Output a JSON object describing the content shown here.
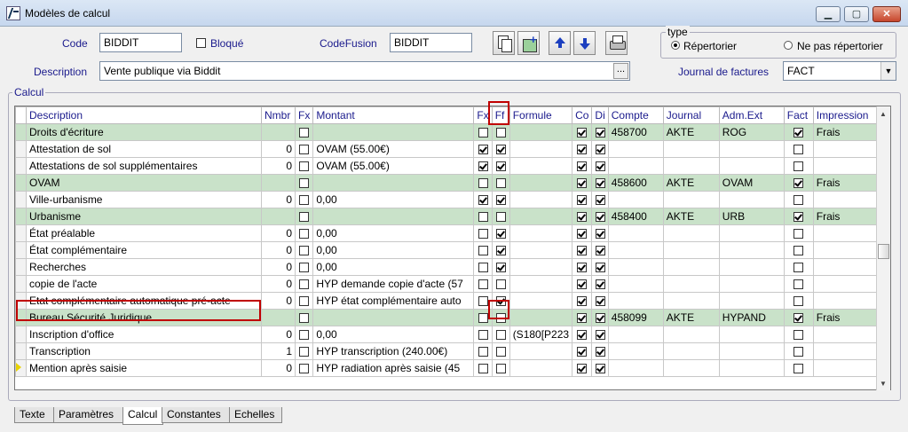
{
  "window": {
    "title": "Modèles de calcul"
  },
  "header": {
    "code_label": "Code",
    "code_value": "BIDDIT",
    "bloque_label": "Bloqué",
    "codefusion_label": "CodeFusion",
    "codefusion_value": "BIDDIT",
    "description_label": "Description",
    "description_value": "Vente publique via Biddit",
    "description_button": "...",
    "journal_label": "Journal de factures",
    "journal_value": "FACT"
  },
  "type_group": {
    "label": "type",
    "option1": "Répertorier",
    "option2": "Ne pas répertorier",
    "selected": "Répertorier"
  },
  "calcul_group": {
    "label": "Calcul"
  },
  "columns": [
    "Description",
    "Nmbr",
    "Fx",
    "Montant",
    "Fx",
    "Ff",
    "Formule",
    "Co",
    "Di",
    "Compte",
    "Journal",
    "Adm.Ext",
    "Fact",
    "Impression"
  ],
  "rows": [
    {
      "group": true,
      "desc": "Droits d'écriture",
      "nmbr": "",
      "fx1": false,
      "montant": "",
      "fx2": false,
      "ff": false,
      "formule": "",
      "co": true,
      "di": true,
      "compte": "458700",
      "journal": "AKTE",
      "adm": "ROG",
      "fact": true,
      "impression": "Frais"
    },
    {
      "group": false,
      "desc": "Attestation de sol",
      "nmbr": "0",
      "fx1": false,
      "montant": "OVAM (55.00€)",
      "fx2": true,
      "ff": true,
      "formule": "",
      "co": true,
      "di": true,
      "compte": "",
      "journal": "",
      "adm": "",
      "fact": false,
      "impression": ""
    },
    {
      "group": false,
      "desc": "Attestations de sol supplémentaires",
      "nmbr": "0",
      "fx1": false,
      "montant": "OVAM (55.00€)",
      "fx2": true,
      "ff": true,
      "formule": "",
      "co": true,
      "di": true,
      "compte": "",
      "journal": "",
      "adm": "",
      "fact": false,
      "impression": ""
    },
    {
      "group": true,
      "desc": "OVAM",
      "nmbr": "",
      "fx1": false,
      "montant": "",
      "fx2": false,
      "ff": false,
      "formule": "",
      "co": true,
      "di": true,
      "compte": "458600",
      "journal": "AKTE",
      "adm": "OVAM",
      "fact": true,
      "impression": "Frais"
    },
    {
      "group": false,
      "desc": "Ville-urbanisme",
      "nmbr": "0",
      "fx1": false,
      "montant": "0,00",
      "fx2": true,
      "ff": true,
      "formule": "",
      "co": true,
      "di": true,
      "compte": "",
      "journal": "",
      "adm": "",
      "fact": false,
      "impression": ""
    },
    {
      "group": true,
      "desc": "Urbanisme",
      "nmbr": "",
      "fx1": false,
      "montant": "",
      "fx2": false,
      "ff": false,
      "formule": "",
      "co": true,
      "di": true,
      "compte": "458400",
      "journal": "AKTE",
      "adm": "URB",
      "fact": true,
      "impression": "Frais"
    },
    {
      "group": false,
      "desc": "État préalable",
      "nmbr": "0",
      "fx1": false,
      "montant": "0,00",
      "fx2": false,
      "ff": true,
      "formule": "",
      "co": true,
      "di": true,
      "compte": "",
      "journal": "",
      "adm": "",
      "fact": false,
      "impression": ""
    },
    {
      "group": false,
      "desc": "État complémentaire",
      "nmbr": "0",
      "fx1": false,
      "montant": "0,00",
      "fx2": false,
      "ff": true,
      "formule": "",
      "co": true,
      "di": true,
      "compte": "",
      "journal": "",
      "adm": "",
      "fact": false,
      "impression": ""
    },
    {
      "group": false,
      "desc": "Recherches",
      "nmbr": "0",
      "fx1": false,
      "montant": "0,00",
      "fx2": false,
      "ff": true,
      "formule": "",
      "co": true,
      "di": true,
      "compte": "",
      "journal": "",
      "adm": "",
      "fact": false,
      "impression": ""
    },
    {
      "group": false,
      "desc": "copie de l'acte",
      "nmbr": "0",
      "fx1": false,
      "montant": "HYP demande copie d'acte (57",
      "fx2": false,
      "ff": false,
      "formule": "",
      "co": true,
      "di": true,
      "compte": "",
      "journal": "",
      "adm": "",
      "fact": false,
      "impression": ""
    },
    {
      "group": false,
      "desc": "Etat complémentaire automatique pré-acte",
      "nmbr": "0",
      "fx1": false,
      "montant": "HYP état complémentaire auto",
      "fx2": false,
      "ff": true,
      "formule": "",
      "co": true,
      "di": true,
      "compte": "",
      "journal": "",
      "adm": "",
      "fact": false,
      "impression": ""
    },
    {
      "group": true,
      "desc": "Bureau Sécurité Juridique",
      "nmbr": "",
      "fx1": false,
      "montant": "",
      "fx2": false,
      "ff": false,
      "formule": "",
      "co": true,
      "di": true,
      "compte": "458099",
      "journal": "AKTE",
      "adm": "HYPAND",
      "fact": true,
      "impression": "Frais"
    },
    {
      "group": false,
      "desc": "Inscription d'office",
      "nmbr": "0",
      "fx1": false,
      "montant": "0,00",
      "fx2": false,
      "ff": false,
      "formule": "(S180[P223",
      "co": true,
      "di": true,
      "compte": "",
      "journal": "",
      "adm": "",
      "fact": false,
      "impression": ""
    },
    {
      "group": false,
      "desc": "Transcription",
      "nmbr": "1",
      "fx1": false,
      "montant": "HYP transcription (240.00€)",
      "fx2": false,
      "ff": false,
      "formule": "",
      "co": true,
      "di": true,
      "compte": "",
      "journal": "",
      "adm": "",
      "fact": false,
      "impression": ""
    },
    {
      "group": false,
      "desc": "Mention après saisie",
      "nmbr": "0",
      "fx1": false,
      "montant": "HYP radiation après saisie (45",
      "fx2": false,
      "ff": false,
      "formule": "",
      "co": true,
      "di": true,
      "compte": "",
      "journal": "",
      "adm": "",
      "fact": false,
      "impression": ""
    }
  ],
  "tabs": [
    "Texte",
    "Paramètres",
    "Calcul",
    "Constantes",
    "Echelles"
  ],
  "active_tab": "Calcul"
}
